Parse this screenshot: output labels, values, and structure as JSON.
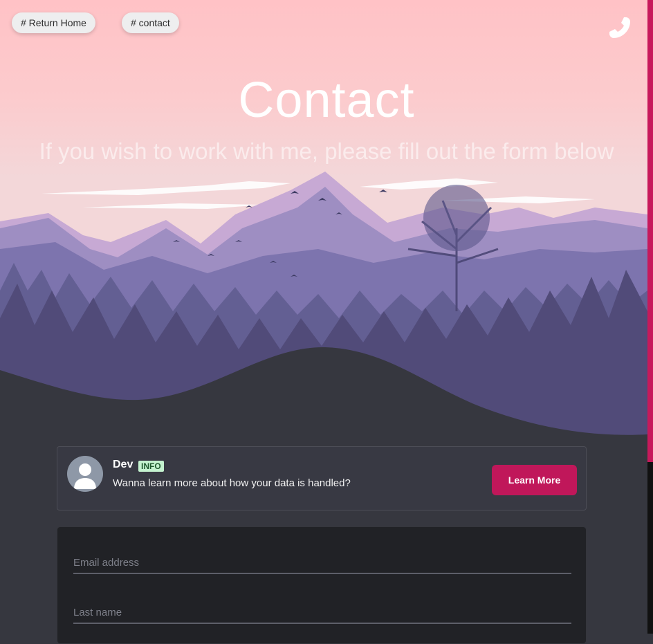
{
  "nav": {
    "home_label": "# Return Home",
    "contact_label": "# contact"
  },
  "hero": {
    "title": "Contact",
    "subtitle": "If you wish to work with me, please fill out the form below"
  },
  "info_card": {
    "name": "Dev",
    "badge": "INFO",
    "message": "Wanna learn more about how your data is handled?",
    "button_label": "Learn More"
  },
  "form": {
    "email_placeholder": "Email address",
    "last_name_placeholder": "Last name"
  },
  "icons": {
    "phone": "phone-icon",
    "avatar": "user-avatar-icon"
  },
  "colors": {
    "accent": "#c0175a",
    "background": "#36373f",
    "badge_bg": "#c4f2cf"
  }
}
